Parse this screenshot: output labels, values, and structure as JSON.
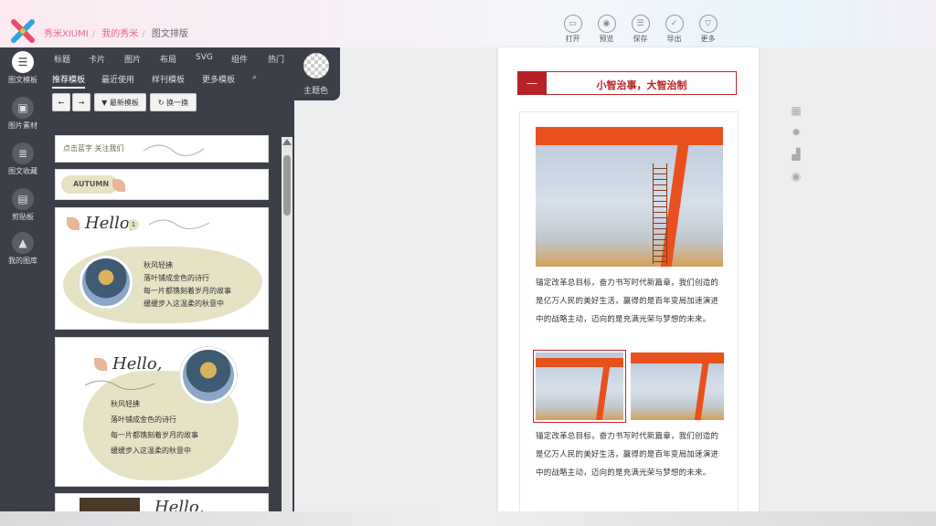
{
  "header": {
    "breadcrumb": [
      "秀米XIUMI",
      "我的秀米",
      "图文排版"
    ],
    "toolbar": [
      {
        "label": "打开",
        "icon": "folder-icon"
      },
      {
        "label": "预览",
        "icon": "preview-icon"
      },
      {
        "label": "保存",
        "icon": "save-icon"
      },
      {
        "label": "导出",
        "icon": "check-icon"
      },
      {
        "label": "更多",
        "icon": "chevron-down-icon"
      }
    ]
  },
  "rail": [
    {
      "label": "图文模板",
      "icon": "menu-icon"
    },
    {
      "label": "图片素材",
      "icon": "image-icon"
    },
    {
      "label": "图文收藏",
      "icon": "collection-icon"
    },
    {
      "label": "剪贴板",
      "icon": "clipboard-icon"
    },
    {
      "label": "我的图库",
      "icon": "gallery-icon"
    }
  ],
  "categories": [
    "标题",
    "卡片",
    "图片",
    "布局",
    "SVG",
    "组件",
    "热门"
  ],
  "subtabs": [
    "推荐模板",
    "最近使用",
    "样刊模板",
    "更多模板"
  ],
  "theme_label": "主题色",
  "controls": {
    "newest": "最新模板",
    "shuffle": "换一换"
  },
  "templates": {
    "follow_text": "点击蓝字 关注我们",
    "autumn": "AUTUMN",
    "hello": "Hello,",
    "badge": "1",
    "poem": [
      "秋风轻拂",
      "落叶铺成金色的诗行",
      "每一片都镌刻着岁月的故事",
      "缓缓步入这温柔的秋意中"
    ]
  },
  "article": {
    "title": "小智治事，大智治制",
    "paragraph": "锚定改革总目标，奋力书写时代新篇章，我们创造的是亿万人民的美好生活，赢得的是百年变局加速演进中的战略主动，迈向的是充满光荣与梦想的未来。"
  },
  "right_icons": [
    "grid-icon",
    "gear-icon",
    "bar-chart-icon",
    "eye-icon"
  ]
}
